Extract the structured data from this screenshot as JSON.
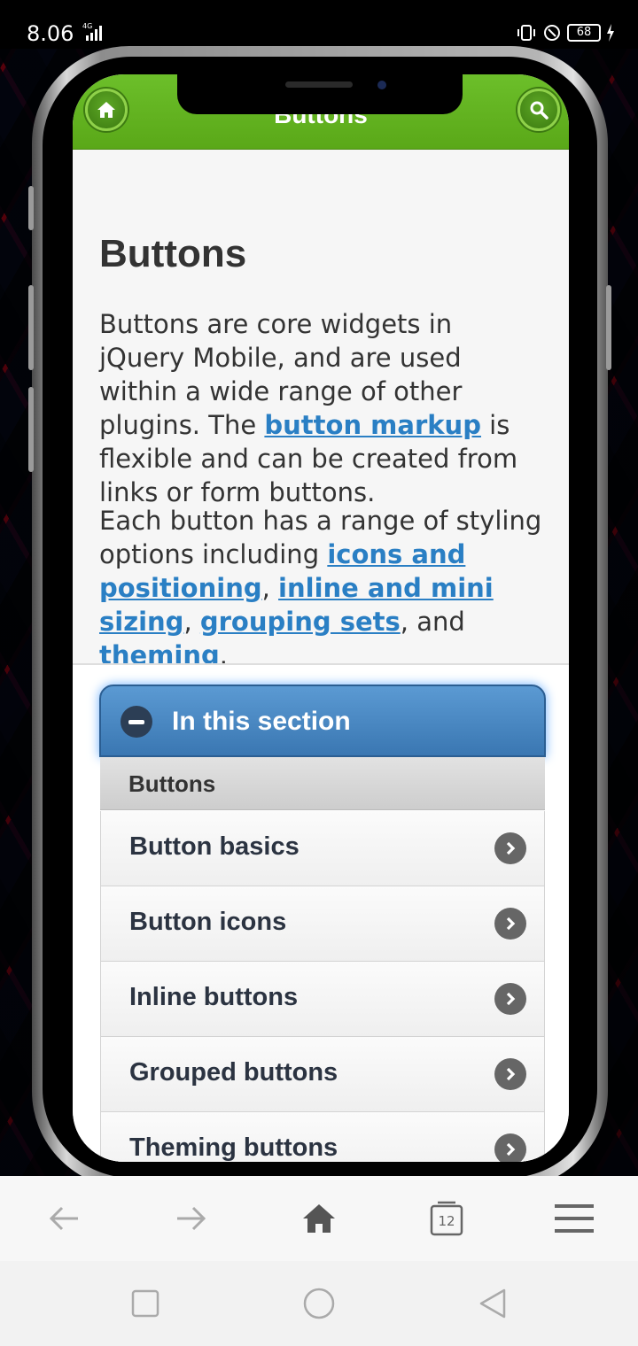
{
  "status_bar": {
    "time": "8.06",
    "network": "4G",
    "battery": "68"
  },
  "header": {
    "title": "Buttons",
    "home_icon": "home-icon",
    "search_icon": "search-icon",
    "accent": "#6cbf2a"
  },
  "page": {
    "heading": "Buttons",
    "para1": {
      "text_before": "Buttons are core widgets in jQuery Mobile, and are used within a wide range of other plugins. The ",
      "link": "button markup",
      "text_after": " is flexible and can be created from links or form buttons."
    },
    "para2": {
      "text_before": "Each button has a range of styling options including ",
      "link1": "icons and positioning",
      "sep1": ", ",
      "link2": "inline and mini sizing",
      "sep2": ", ",
      "link3": "grouping sets",
      "sep3": ", and ",
      "link4": "theming",
      "end": "."
    }
  },
  "collapsible": {
    "title": "In this section",
    "divider": "Buttons",
    "items": [
      {
        "label": "Button basics"
      },
      {
        "label": "Button icons"
      },
      {
        "label": "Inline buttons"
      },
      {
        "label": "Grouped buttons"
      },
      {
        "label": "Theming buttons"
      }
    ],
    "accent": "#3a77b2"
  },
  "browser_bar": {
    "back_icon": "arrow-left-icon",
    "forward_icon": "arrow-right-icon",
    "home_icon": "home-icon",
    "tabs_count": "12",
    "menu_icon": "menu-icon"
  },
  "nav_bar": {
    "recent_icon": "square-icon",
    "home_icon": "circle-icon",
    "back_icon": "triangle-back-icon"
  }
}
